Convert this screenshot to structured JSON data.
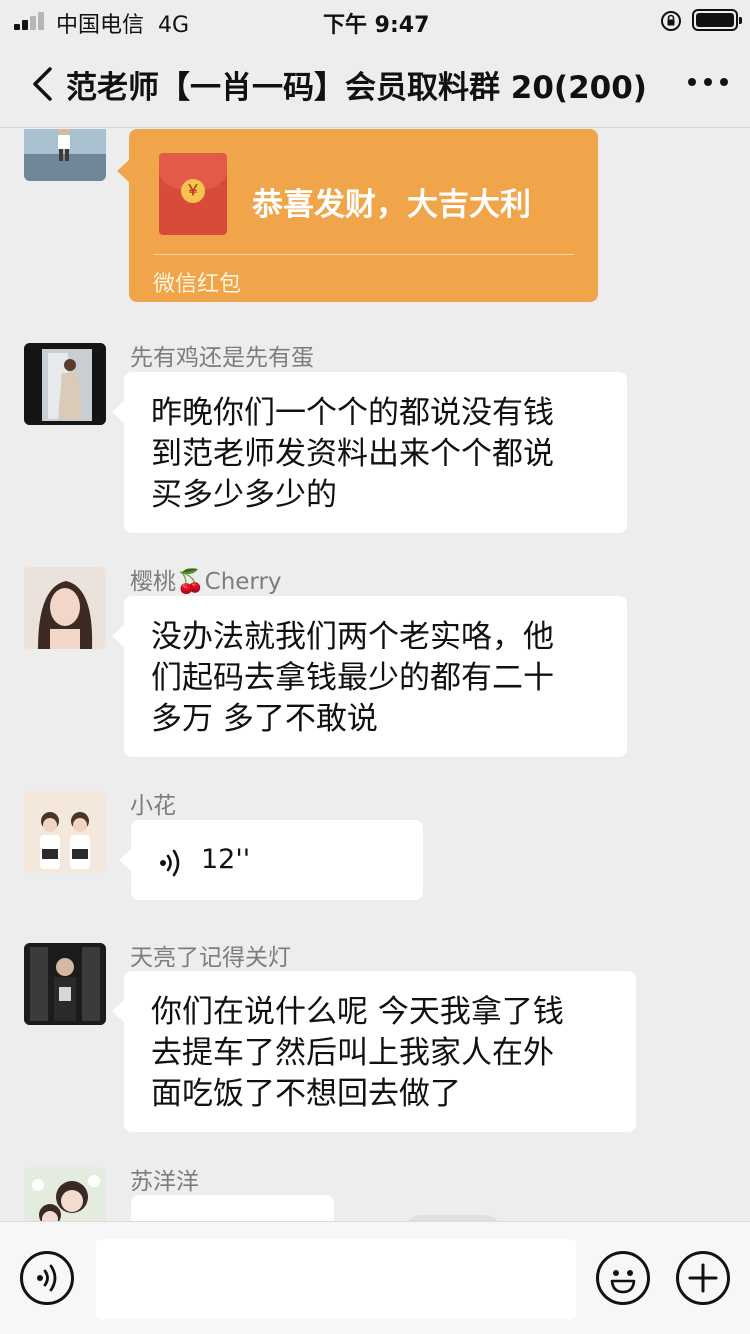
{
  "status_bar": {
    "carrier": "中国电信",
    "network": "4G",
    "time": "下午 9:47"
  },
  "nav": {
    "title": "范老师【一肖一码】会员取料群 20(200)"
  },
  "messages": [
    {
      "type": "red_packet",
      "text": "恭喜发财，大吉大利",
      "label": "微信红包",
      "coin_symbol": "￥"
    },
    {
      "type": "text",
      "sender": "先有鸡还是先有蛋",
      "lines": [
        "昨晚你们一个个的都说没有钱",
        "到范老师发资料出来个个都说",
        "买多少多少的"
      ]
    },
    {
      "type": "text",
      "sender": "樱桃🍒Cherry",
      "lines": [
        "没办法就我们两个老实咯，他",
        "们起码去拿钱最少的都有二十",
        "多万 多了不敢说"
      ]
    },
    {
      "type": "voice",
      "sender": "小花",
      "duration": "12''"
    },
    {
      "type": "text",
      "sender": "天亮了记得关灯",
      "lines": [
        "你们在说什么呢 今天我拿了钱",
        "去提车了然后叫上我家人在外",
        "面吃饭了不想回去做了"
      ]
    },
    {
      "type": "partial",
      "sender": "苏洋洋"
    }
  ],
  "colors": {
    "background": "#ededed",
    "bubble": "#ffffff",
    "red_packet": "#f0a54b",
    "sender_name": "#7d7d7d"
  }
}
